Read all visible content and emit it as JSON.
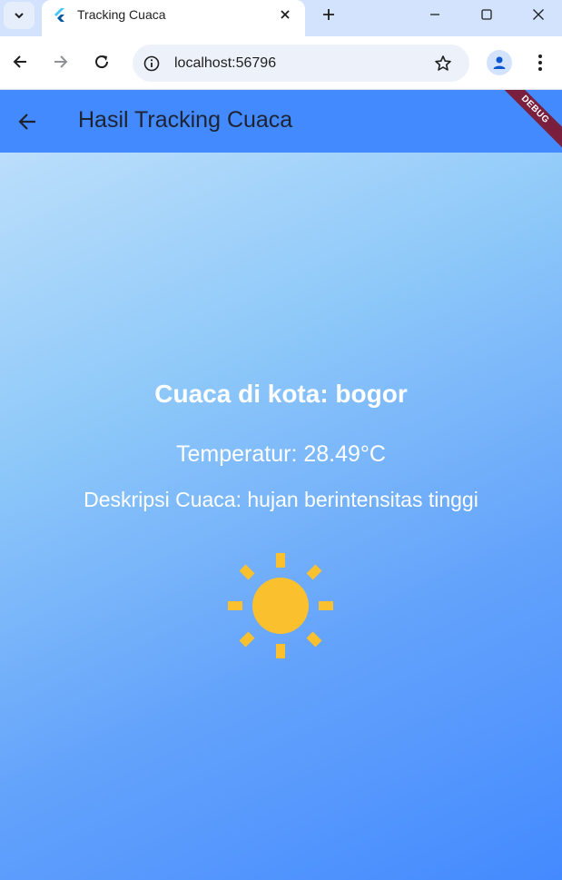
{
  "browser": {
    "tab_title": "Tracking Cuaca",
    "url": "localhost:56796"
  },
  "app": {
    "title": "Hasil Tracking Cuaca",
    "debug_label": "DEBUG",
    "city_text": "Cuaca di kota: bogor",
    "temperature_text": "Temperatur: 28.49°C",
    "description_text": "Deskripsi Cuaca: hujan berintensitas tinggi",
    "weather_icon": "sun-icon"
  },
  "colors": {
    "appbar": "#448aff",
    "sun": "#fbc02d",
    "debug_banner": "#7a1f3d"
  }
}
